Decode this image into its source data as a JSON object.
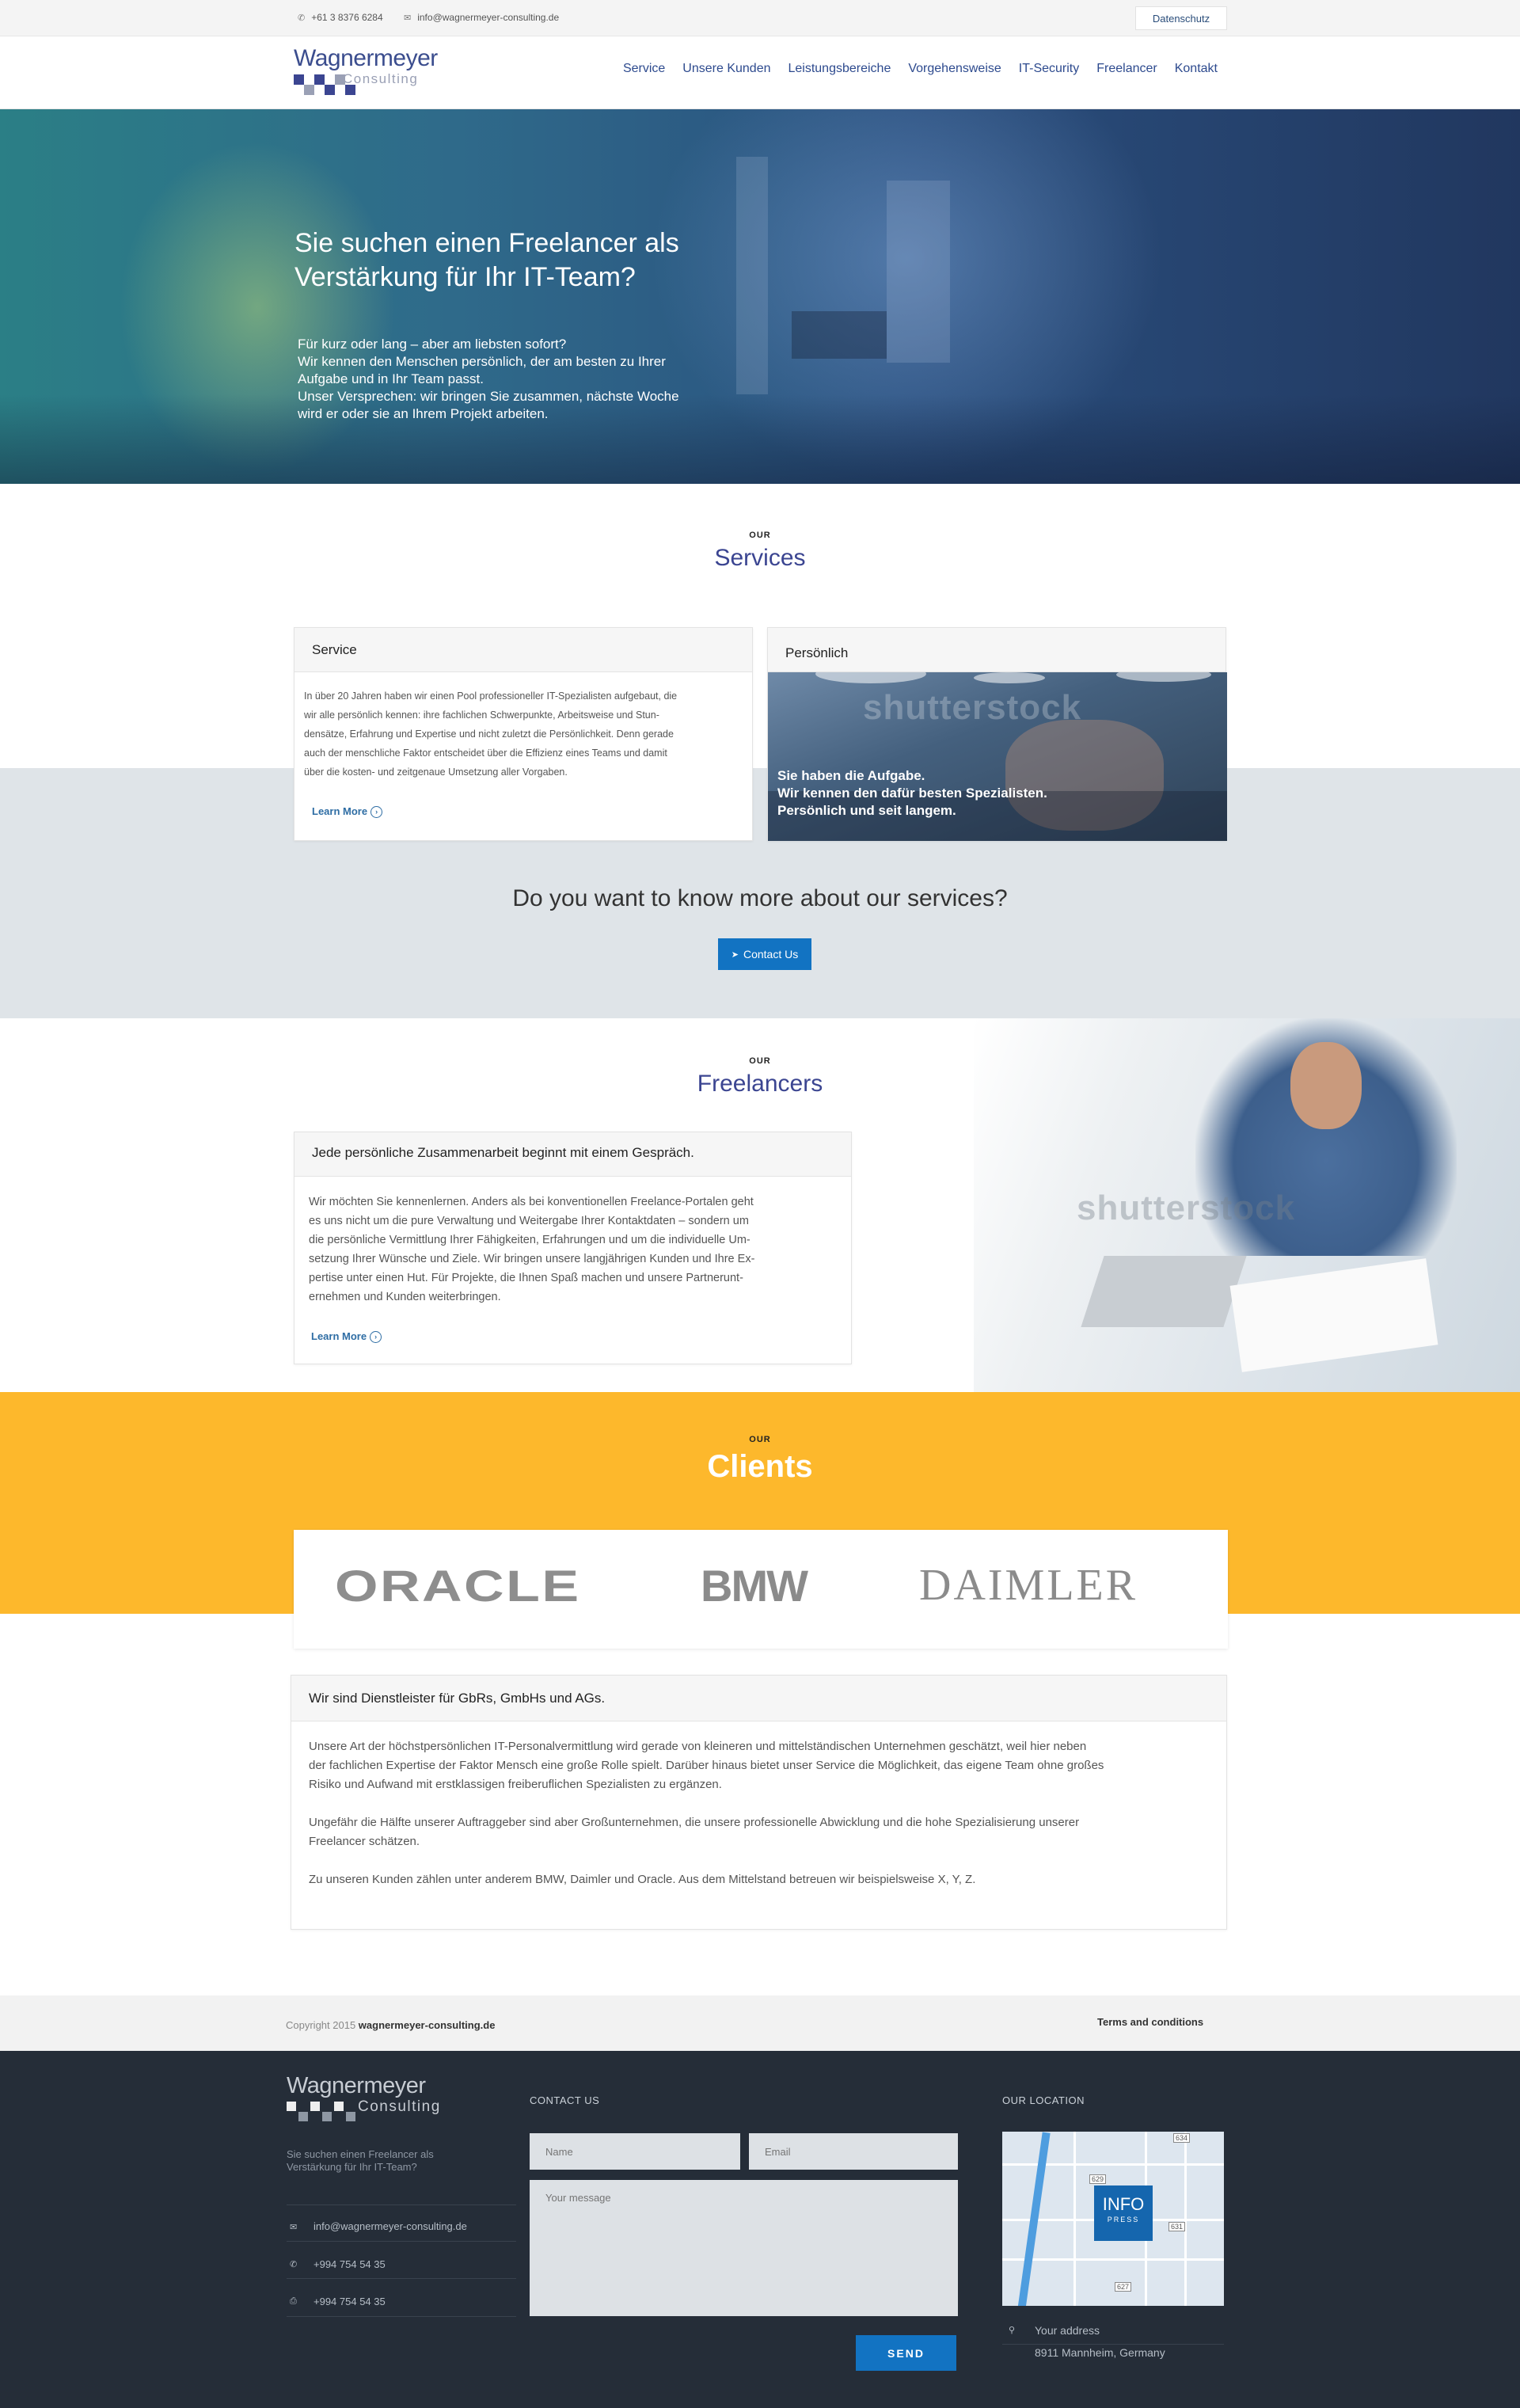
{
  "topbar": {
    "phone": "+61 3 8376 6284",
    "email": "info@wagnermeyer-consulting.de",
    "datenschutz": "Datenschutz"
  },
  "logo": {
    "name": "Wagnermeyer",
    "sub": "Consulting"
  },
  "nav": [
    "Service",
    "Unsere Kunden",
    "Leistungsbereiche",
    "Vorgehensweise",
    "IT-Security",
    "Freelancer",
    "Kontakt"
  ],
  "hero": {
    "title": "Sie suchen einen Freelancer als Verstärkung für Ihr IT-Team?",
    "text_lines": [
      "Für kurz oder lang – aber am liebsten sofort?",
      "Wir kennen den Menschen persönlich, der am besten zu Ihrer",
      "Aufgabe und in Ihr Team passt.",
      "Unser Versprechen: wir bringen Sie zusammen, nächste Woche",
      "wird er oder sie an Ihrem Projekt arbeiten."
    ]
  },
  "services": {
    "label": "OUR",
    "title": "Services",
    "card1": {
      "title": "Service",
      "lines": [
        "In über 20 Jahren haben wir einen Pool professioneller IT-Spezialisten aufgebaut, die",
        "wir alle persönlich kennen: ihre fachlichen Schwerpunkte, Arbeitsweise und Stun-",
        "densätze, Erfahrung und Expertise und nicht zuletzt die Persönlichkeit. Denn gerade",
        "auch der menschliche Faktor entscheidet über die Effizienz eines Teams und damit",
        "über die kosten- und zeitgenaue Umsetzung aller Vorgaben."
      ],
      "more": "Learn More"
    },
    "card2": {
      "title": "Persönlich",
      "image_lines": [
        "Sie haben die Aufgabe.",
        "Wir kennen den dafür besten Spezialisten.",
        "Persönlich und seit langem."
      ],
      "watermark": "shutterstock"
    },
    "cta": {
      "question": "Do you want to know more about our services?",
      "button": "Contact Us"
    }
  },
  "freelancers": {
    "label": "OUR",
    "title": "Freelancers",
    "card": {
      "title": "Jede persönliche Zusammenarbeit beginnt mit einem Gespräch.",
      "lines": [
        "Wir möchten Sie kennenlernen. Anders als bei konventionellen Freelance-Portalen geht",
        "es uns nicht um die pure Verwaltung und Weitergabe Ihrer Kontaktdaten – sondern um",
        "die persönliche Vermittlung Ihrer Fähigkeiten, Erfahrungen und um die individuelle Um-",
        "setzung Ihrer Wünsche und Ziele. Wir bringen unsere langjährigen Kunden und Ihre Ex-",
        "pertise unter einen Hut. Für Projekte, die Ihnen Spaß machen und unsere Partnerunt-",
        "ernehmen und Kunden weiterbringen."
      ],
      "more": "Learn More"
    },
    "watermark": "shutterstock"
  },
  "clients": {
    "label": "OUR",
    "title": "Clients",
    "logos": [
      "ORACLE",
      "BMW",
      "DAIMLER"
    ]
  },
  "about": {
    "title": "Wir sind Dienstleister für GbRs, GmbHs und AGs.",
    "p1": [
      "Unsere Art der höchstpersönlichen IT-Personalvermittlung wird gerade von kleineren und mittelständischen Unternehmen geschätzt, weil hier neben",
      "der fachlichen Expertise der Faktor Mensch eine große Rolle spielt. Darüber hinaus bietet unser Service die Möglichkeit, das eigene Team ohne großes",
      "Risiko und Aufwand mit erstklassigen freiberuflichen Spezialisten zu ergänzen."
    ],
    "p2": [
      "Ungefähr die Hälfte unserer Auftraggeber sind aber Großunternehmen, die unsere professionelle Abwicklung und die hohe Spezialisierung unserer",
      "Freelancer schätzen."
    ],
    "p3": "Zu unseren Kunden zählen unter anderem BMW, Daimler und Oracle. Aus dem Mittelstand betreuen wir beispielsweise X, Y, Z."
  },
  "footer": {
    "copyright": "Copyright 2015",
    "domain": "wagnermeyer-consulting.de",
    "terms": "Terms and conditions",
    "tagline_lines": [
      "Sie suchen einen Freelancer als",
      "Verstärkung für Ihr IT-Team?"
    ],
    "email": "info@wagnermeyer-consulting.de",
    "phone": "+994 754 54 35",
    "fax": "+994 754 54 35",
    "contact_title": "CONTACT US",
    "name_ph": "Name",
    "email_ph": "Email",
    "message_ph": "Your message",
    "send": "SEND",
    "location_title": "OUR LOCATION",
    "map_badge": "INFO",
    "map_badge_sub": "PRESS",
    "address_label": "Your address",
    "address": "8911 Mannheim, Germany"
  },
  "colors": {
    "brand": "#3b4591",
    "accent": "#1273c2",
    "clients_bg": "#fdb82c",
    "footer_bg": "#252d38"
  }
}
